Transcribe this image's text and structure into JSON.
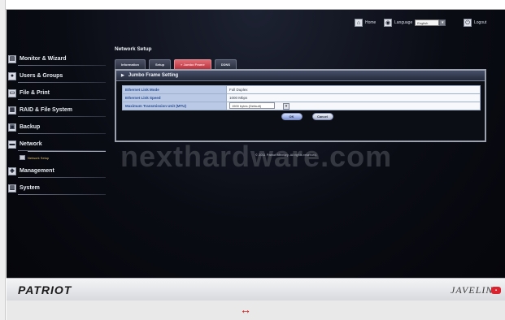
{
  "header": {
    "home_label": "Home",
    "language_label": "Language",
    "language_value": "English",
    "logout_label": "Logout"
  },
  "sidebar": {
    "items": [
      {
        "label": "Monitor & Wizard"
      },
      {
        "label": "Users & Groups"
      },
      {
        "label": "File & Print"
      },
      {
        "label": "RAID & File System"
      },
      {
        "label": "Backup"
      },
      {
        "label": "Network"
      },
      {
        "label": "Management"
      },
      {
        "label": "System"
      }
    ],
    "network_sub": "Network Setup"
  },
  "main": {
    "title": "Network Setup",
    "tabs": [
      "Information",
      "Setup",
      "» Jumbo Frame",
      "DDNS"
    ],
    "panel_title": "Jumbo Frame Setting",
    "rows": [
      {
        "label": "Ethernet Link Mode",
        "value": "Full Duplex"
      },
      {
        "label": "Ethernet Link Speed",
        "value": "1000 Mbps"
      },
      {
        "label": "Maximum Transmission Unit (MTU)",
        "value": "1500 bytes (Default)"
      }
    ],
    "ok_label": "OK",
    "cancel_label": "Cancel",
    "copyright": "© 2011 Patriot Memory. All rights reserved."
  },
  "watermark": "nexthardware.com",
  "footer": {
    "brand_left": "PATRIOT",
    "brand_right": "JAVELIN"
  },
  "resize_glyph": "↔"
}
